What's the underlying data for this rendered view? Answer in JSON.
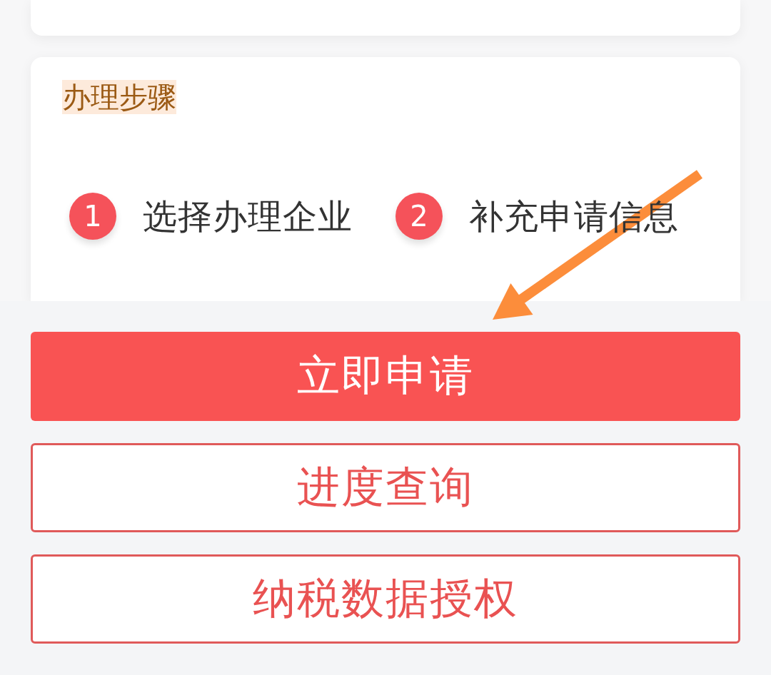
{
  "steps_card": {
    "title": "办理步骤",
    "steps": [
      {
        "number": "1",
        "label": "选择办理企业"
      },
      {
        "number": "2",
        "label": "补充申请信息"
      }
    ]
  },
  "actions": [
    {
      "label": "立即申请",
      "kind": "primary"
    },
    {
      "label": "进度查询",
      "kind": "outline"
    },
    {
      "label": "纳税数据授权",
      "kind": "outline"
    }
  ]
}
